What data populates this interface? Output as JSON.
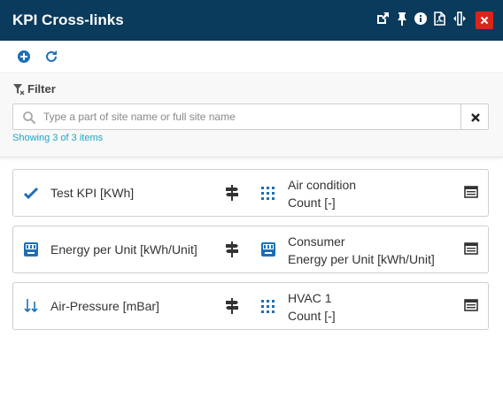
{
  "header": {
    "title": "KPI Cross-links",
    "icons": [
      "external-link-icon",
      "pin-icon",
      "info-icon",
      "pdf-icon",
      "resize-icon",
      "close-icon"
    ],
    "close_color": "#d9261c",
    "background_color": "#0a3a5c"
  },
  "toolbar": {
    "icons": [
      "add-icon",
      "refresh-icon"
    ],
    "accent_color": "#1c6fb7"
  },
  "filter": {
    "label": "Filter",
    "placeholder": "Type a part of site name or full site name",
    "value": "",
    "showing_text": "Showing 3 of 3 items"
  },
  "crosslinks": [
    {
      "kpi_icon": "check-icon",
      "kpi_label": "Test KPI [KWh]",
      "link_icon": "signpost-icon",
      "target_icon": "grid-icon",
      "target_line1": "Air condition",
      "target_line2": "Count [-]",
      "details_icon": "details-icon"
    },
    {
      "kpi_icon": "meter-icon",
      "kpi_label": "Energy per Unit [kWh/Unit]",
      "link_icon": "signpost-icon",
      "target_icon": "meter-icon",
      "target_line1": "Consumer",
      "target_line2": "Energy per Unit [kWh/Unit]",
      "details_icon": "details-icon"
    },
    {
      "kpi_icon": "pressure-icon",
      "kpi_label": "Air-Pressure [mBar]",
      "link_icon": "signpost-icon",
      "target_icon": "grid-icon",
      "target_line1": "HVAC 1",
      "target_line2": "Count [-]",
      "details_icon": "details-icon"
    }
  ]
}
